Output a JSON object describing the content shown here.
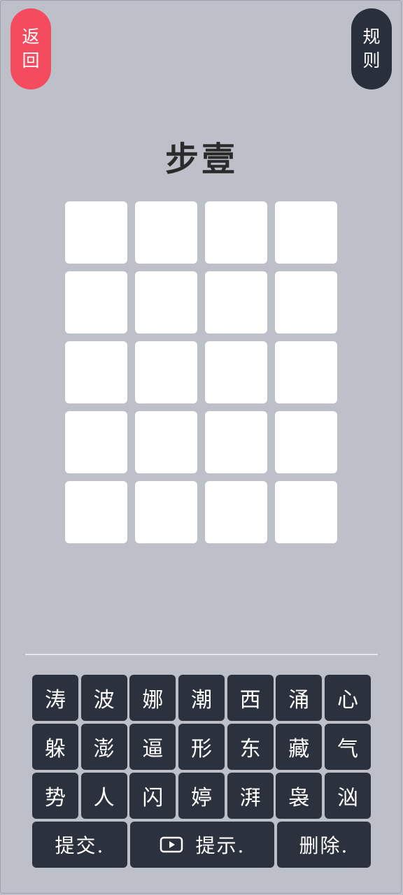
{
  "header": {
    "back_label": [
      "返",
      "回"
    ],
    "rules_label": [
      "规",
      "则"
    ]
  },
  "title": "步壹",
  "board": {
    "rows": 5,
    "cols": 4
  },
  "keyboard": {
    "keys": [
      "涛",
      "波",
      "娜",
      "潮",
      "西",
      "涌",
      "心",
      "躲",
      "澎",
      "逼",
      "形",
      "东",
      "藏",
      "气",
      "势",
      "人",
      "闪",
      "婷",
      "湃",
      "袅",
      "汹"
    ],
    "submit_label": "提交.",
    "hint_label": "提示.",
    "delete_label": "删除."
  },
  "colors": {
    "background": "#bdbfc9",
    "back_button": "#f54b5e",
    "dark_button": "#2c313e",
    "cell": "#ffffff"
  },
  "icons": {
    "hint": "video-play-icon"
  }
}
